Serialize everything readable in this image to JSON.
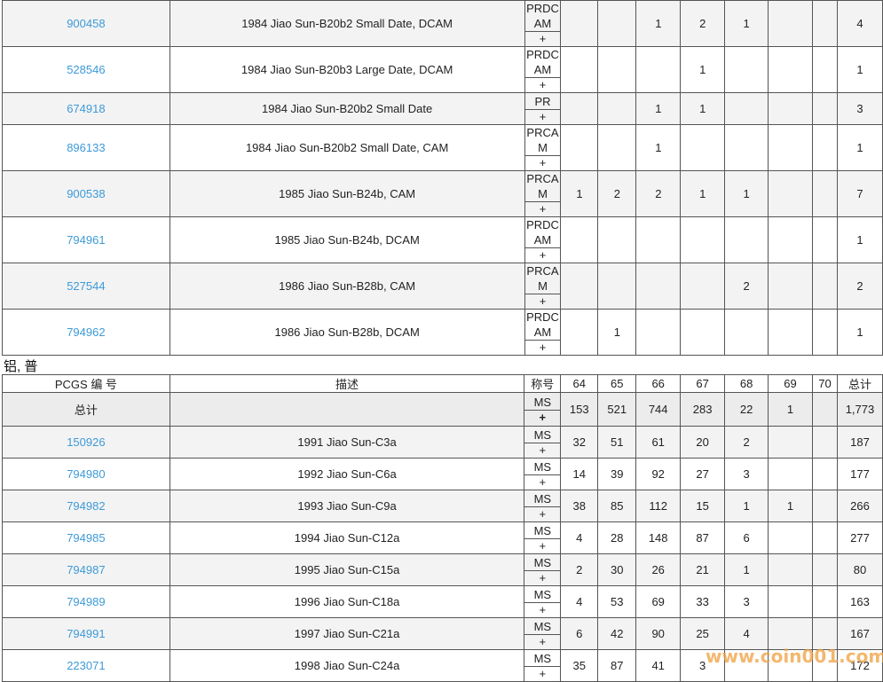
{
  "section1": {
    "rows": [
      {
        "id": "900458",
        "desc": "1984 Jiao Sun-B20b2 Small Date, DCAM",
        "grade": "PRDCAM",
        "plus": "+",
        "c64": "",
        "c65": "",
        "c66": "1",
        "c67": "2",
        "c68": "1",
        "c69": "",
        "c70": "",
        "total": "4"
      },
      {
        "id": "528546",
        "desc": "1984 Jiao Sun-B20b3 Large Date, DCAM",
        "grade": "PRDCAM",
        "plus": "+",
        "c64": "",
        "c65": "",
        "c66": "",
        "c67": "1",
        "c68": "",
        "c69": "",
        "c70": "",
        "total": "1"
      },
      {
        "id": "674918",
        "desc": "1984 Jiao Sun-B20b2 Small Date",
        "grade": "PR",
        "plus": "+",
        "c64": "",
        "c65": "",
        "c66": "1",
        "c67": "1",
        "c68": "",
        "c69": "",
        "c70": "",
        "total": "3"
      },
      {
        "id": "896133",
        "desc": "1984 Jiao Sun-B20b2 Small Date, CAM",
        "grade": "PRCAM",
        "plus": "+",
        "c64": "",
        "c65": "",
        "c66": "1",
        "c67": "",
        "c68": "",
        "c69": "",
        "c70": "",
        "total": "1"
      },
      {
        "id": "900538",
        "desc": "1985 Jiao Sun-B24b, CAM",
        "grade": "PRCAM",
        "plus": "+",
        "c64": "1",
        "c65": "2",
        "c66": "2",
        "c67": "1",
        "c68": "1",
        "c69": "",
        "c70": "",
        "total": "7"
      },
      {
        "id": "794961",
        "desc": "1985 Jiao Sun-B24b, DCAM",
        "grade": "PRDCAM",
        "plus": "+",
        "c64": "",
        "c65": "",
        "c66": "",
        "c67": "",
        "c68": "",
        "c69": "",
        "c70": "",
        "total": "1"
      },
      {
        "id": "527544",
        "desc": "1986 Jiao Sun-B28b, CAM",
        "grade": "PRCAM",
        "plus": "+",
        "c64": "",
        "c65": "",
        "c66": "",
        "c67": "",
        "c68": "2",
        "c69": "",
        "c70": "",
        "total": "2"
      },
      {
        "id": "794962",
        "desc": "1986 Jiao Sun-B28b, DCAM",
        "grade": "PRDCAM",
        "plus": "+",
        "c64": "",
        "c65": "1",
        "c66": "",
        "c67": "",
        "c68": "",
        "c69": "",
        "c70": "",
        "total": "1"
      }
    ]
  },
  "section2": {
    "title": "铝, 普",
    "headers": {
      "id": "PCGS 编 号",
      "desc": "描述",
      "grade": "称号",
      "c64": "64",
      "c65": "65",
      "c66": "66",
      "c67": "67",
      "c68": "68",
      "c69": "69",
      "c70": "70",
      "total": "总计"
    },
    "totals": {
      "label": "总计",
      "grade": "MS",
      "plus": "+",
      "c64": "153",
      "c65": "521",
      "c66": "744",
      "c67": "283",
      "c68": "22",
      "c69": "1",
      "c70": "",
      "total": "1,773"
    },
    "rows": [
      {
        "id": "150926",
        "desc": "1991 Jiao Sun-C3a",
        "grade": "MS",
        "plus": "+",
        "c64": "32",
        "c65": "51",
        "c66": "61",
        "c67": "20",
        "c68": "2",
        "c69": "",
        "c70": "",
        "total": "187"
      },
      {
        "id": "794980",
        "desc": "1992 Jiao Sun-C6a",
        "grade": "MS",
        "plus": "+",
        "c64": "14",
        "c65": "39",
        "c66": "92",
        "c67": "27",
        "c68": "3",
        "c69": "",
        "c70": "",
        "total": "177"
      },
      {
        "id": "794982",
        "desc": "1993 Jiao Sun-C9a",
        "grade": "MS",
        "plus": "+",
        "c64": "38",
        "c65": "85",
        "c66": "112",
        "c67": "15",
        "c68": "1",
        "c69": "1",
        "c70": "",
        "total": "266"
      },
      {
        "id": "794985",
        "desc": "1994 Jiao Sun-C12a",
        "grade": "MS",
        "plus": "+",
        "c64": "4",
        "c65": "28",
        "c66": "148",
        "c67": "87",
        "c68": "6",
        "c69": "",
        "c70": "",
        "total": "277"
      },
      {
        "id": "794987",
        "desc": "1995 Jiao Sun-C15a",
        "grade": "MS",
        "plus": "+",
        "c64": "2",
        "c65": "30",
        "c66": "26",
        "c67": "21",
        "c68": "1",
        "c69": "",
        "c70": "",
        "total": "80"
      },
      {
        "id": "794989",
        "desc": "1996 Jiao Sun-C18a",
        "grade": "MS",
        "plus": "+",
        "c64": "4",
        "c65": "53",
        "c66": "69",
        "c67": "33",
        "c68": "3",
        "c69": "",
        "c70": "",
        "total": "163"
      },
      {
        "id": "794991",
        "desc": "1997 Jiao Sun-C21a",
        "grade": "MS",
        "plus": "+",
        "c64": "6",
        "c65": "42",
        "c66": "90",
        "c67": "25",
        "c68": "4",
        "c69": "",
        "c70": "",
        "total": "167"
      },
      {
        "id": "223071",
        "desc": "1998 Jiao Sun-C24a",
        "grade": "MS",
        "plus": "+",
        "c64": "35",
        "c65": "87",
        "c66": "41",
        "c67": "3",
        "c68": "",
        "c69": "",
        "c70": "",
        "total": "172"
      }
    ]
  },
  "watermark": "www.coin001.com"
}
